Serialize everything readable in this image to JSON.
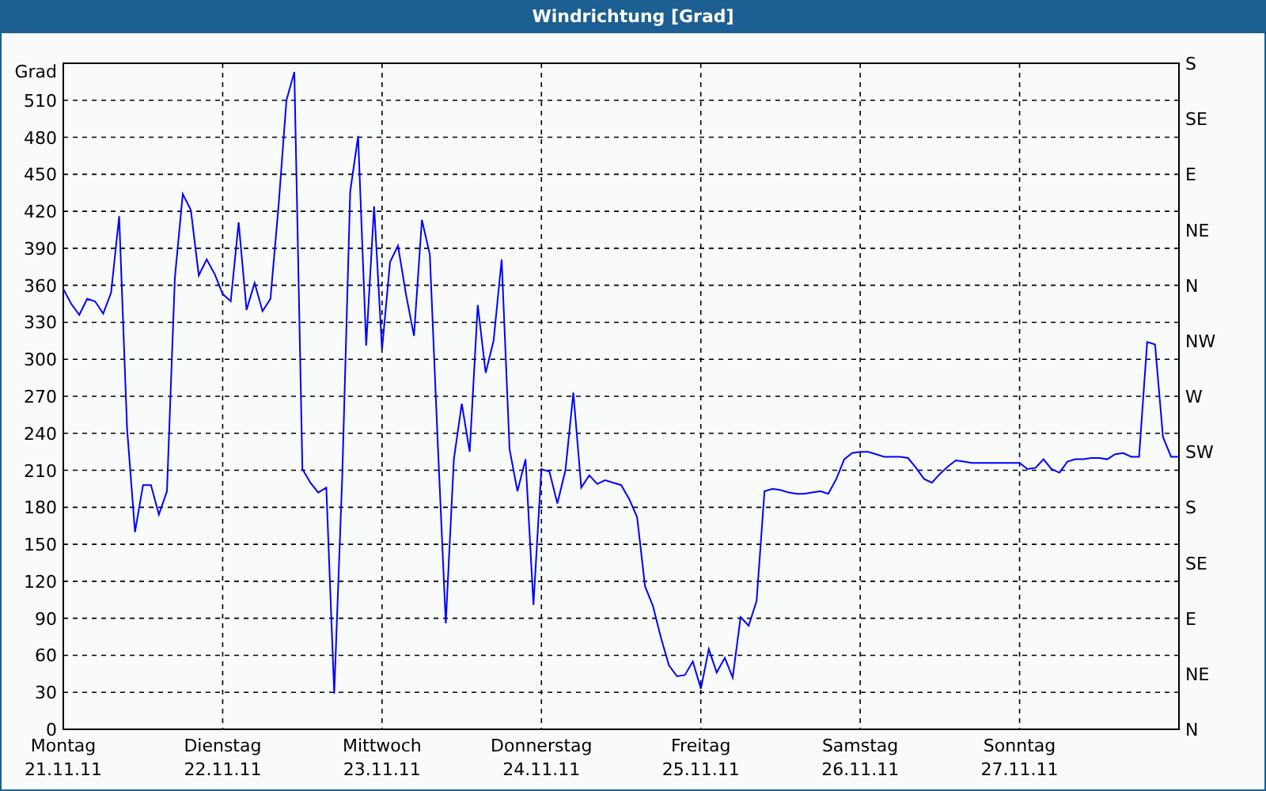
{
  "chart_data": {
    "type": "line",
    "title": "Windrichtung [Grad]",
    "ylabel": "Grad",
    "ylim": [
      0,
      540
    ],
    "grid": true,
    "yticks": [
      0,
      30,
      60,
      90,
      120,
      150,
      180,
      210,
      240,
      270,
      300,
      330,
      360,
      390,
      420,
      450,
      480,
      510
    ],
    "categories": [
      "Montag\n21.11.11",
      null,
      null,
      null,
      null,
      null,
      null,
      null,
      null,
      null,
      null,
      null,
      null,
      null,
      null,
      null,
      null,
      null,
      null,
      null,
      "Dienstag\n22.11.11",
      null,
      null,
      null,
      null,
      null,
      null,
      null,
      null,
      null,
      null,
      null,
      null,
      null,
      null,
      null,
      null,
      null,
      null,
      null,
      "Mittwoch\n23.11.11",
      null,
      null,
      null,
      null,
      null,
      null,
      null,
      null,
      null,
      null,
      null,
      null,
      null,
      null,
      null,
      null,
      null,
      null,
      null,
      "Donnerstag\n24.11.11",
      null,
      null,
      null,
      null,
      null,
      null,
      null,
      null,
      null,
      null,
      null,
      null,
      null,
      null,
      null,
      null,
      null,
      null,
      null,
      "Freitag\n25.11.11",
      null,
      null,
      null,
      null,
      null,
      null,
      null,
      null,
      null,
      null,
      null,
      null,
      null,
      null,
      null,
      null,
      null,
      null,
      null,
      "Samstag\n26.11.11",
      null,
      null,
      null,
      null,
      null,
      null,
      null,
      null,
      null,
      null,
      null,
      null,
      null,
      null,
      null,
      null,
      null,
      null,
      null,
      "Sonntag\n27.11.11",
      null,
      null,
      null,
      null,
      null,
      null,
      null,
      null,
      null,
      null,
      null,
      null,
      null,
      null,
      null,
      null,
      null,
      null,
      null,
      null
    ],
    "series": [
      {
        "color": "#0000ff",
        "values": [
          357,
          345,
          336,
          349,
          347,
          337,
          354,
          416,
          244,
          160,
          198,
          198,
          174,
          193,
          366,
          434,
          421,
          368,
          381,
          369,
          353,
          347,
          411,
          340,
          362,
          339,
          349,
          424,
          510,
          533,
          211,
          200,
          192,
          196,
          29,
          206,
          436,
          481,
          311,
          424,
          308,
          379,
          392,
          353,
          319,
          413,
          385,
          230,
          86,
          219,
          264,
          225,
          344,
          289,
          315,
          381,
          227,
          193,
          219,
          101,
          211,
          209,
          183,
          210,
          273,
          196,
          206,
          199,
          202,
          200,
          198,
          187,
          172,
          116,
          100,
          74,
          52,
          43,
          44,
          55,
          33,
          65,
          46,
          58,
          42,
          91,
          84,
          104,
          193,
          195,
          194,
          192,
          191,
          191,
          192,
          193,
          191,
          203,
          219,
          224,
          225,
          225,
          223,
          221,
          221,
          221,
          220,
          212,
          203,
          200,
          207,
          213,
          218,
          217,
          216,
          216,
          216,
          216,
          216,
          216,
          216,
          211,
          212,
          219,
          211,
          208,
          217,
          219,
          219,
          220,
          220,
          219,
          223,
          224,
          221,
          221,
          314,
          312,
          237,
          221,
          221
        ]
      }
    ]
  },
  "compass_labels": [
    "S",
    "SE",
    "E",
    "NE",
    "N",
    "NW",
    "W",
    "SW",
    "S",
    "SE",
    "E",
    "NE",
    "N"
  ]
}
